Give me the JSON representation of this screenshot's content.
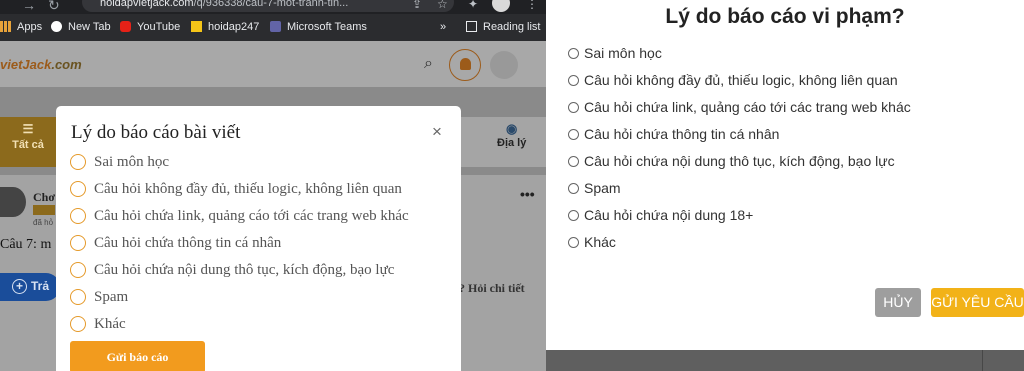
{
  "browser": {
    "url_host": "hoidapvietjack.com",
    "url_path": "/q/936338/cau-7-mot-tranh-tin..."
  },
  "bookmarks": [
    {
      "label": "Apps",
      "icon": "apps-grid-icon"
    },
    {
      "label": "New Tab",
      "icon": "new-tab-icon"
    },
    {
      "label": "YouTube",
      "icon": "youtube-icon"
    },
    {
      "label": "hoidap247",
      "icon": "hoidap247-icon"
    },
    {
      "label": "Microsoft Teams",
      "icon": "teams-icon"
    }
  ],
  "bookmarks_overflow": "»",
  "reading_list": "Reading list",
  "site": {
    "logo_part1": "vietJack",
    "logo_part2": ".com",
    "tab_all": "Tất cả",
    "tab_geo": "Địa lý",
    "post_name": "Chơ",
    "post_meta": "đã hỏ",
    "post_question": "Câu 7: m",
    "post_answer_btn": "Trả",
    "post_detail": "Hỏi chi tiết",
    "post_more": "•••"
  },
  "modal": {
    "title": "Lý do báo cáo bài viết",
    "close": "×",
    "options": [
      "Sai môn học",
      "Câu hỏi không đầy đủ, thiếu logic, không liên quan",
      "Câu hỏi chứa link, quảng cáo tới các trang web khác",
      "Câu hỏi chứa thông tin cá nhân",
      "Câu hỏi chứa nội dung thô tục, kích động, bạo lực",
      "Spam",
      "Khác"
    ],
    "submit": "Gửi báo cáo"
  },
  "panel": {
    "title": "Lý do báo cáo vi phạm?",
    "options": [
      "Sai môn học",
      "Câu hỏi không đầy đủ, thiếu logic, không liên quan",
      "Câu hỏi chứa link, quảng cáo tới các trang web khác",
      "Câu hỏi chứa thông tin cá nhân",
      "Câu hỏi chứa nội dung thô tục, kích động, bạo lực",
      "Spam",
      "Câu hỏi chứa nội dung 18+",
      "Khác"
    ],
    "cancel": "HỦY",
    "send": "GỬI YÊU CẦU"
  },
  "colors": {
    "accent_orange": "#f29b1e",
    "send_yellow": "#f2b218",
    "cancel_gray": "#9e9e9e",
    "brand_brown": "#8c6a1c"
  }
}
